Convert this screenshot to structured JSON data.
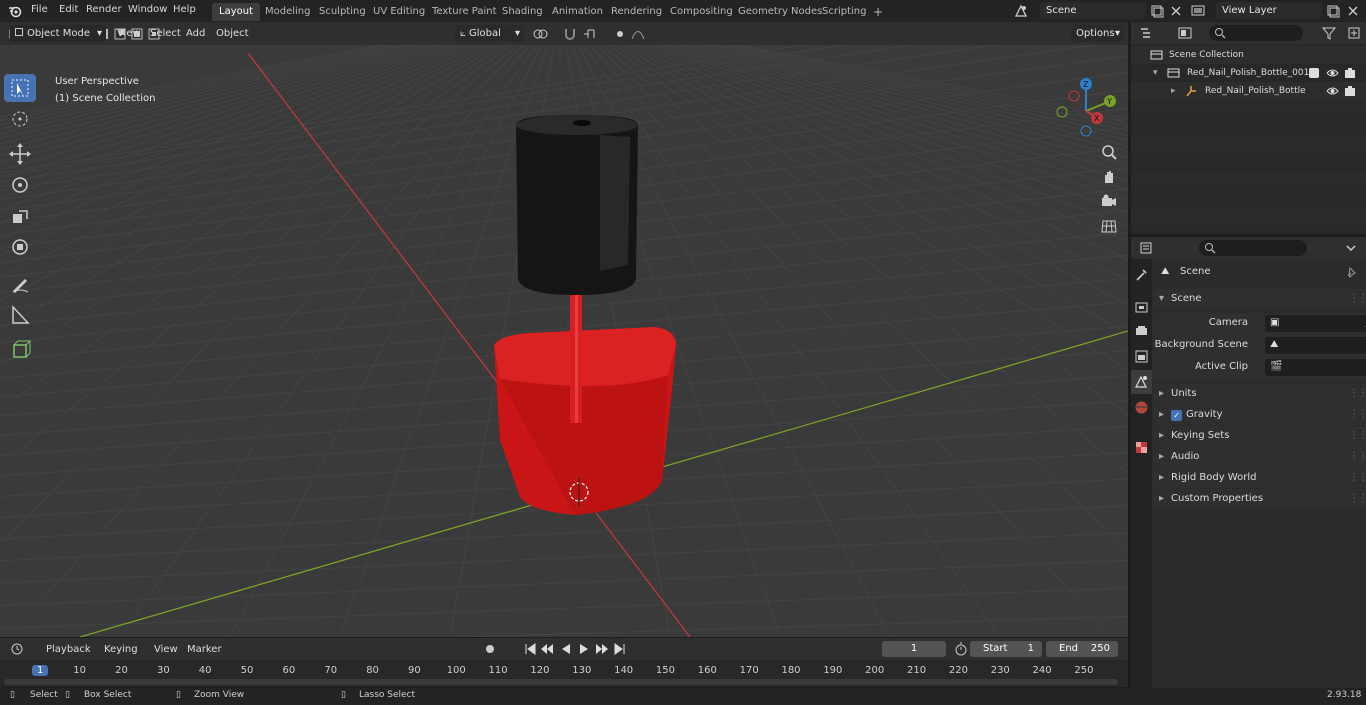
{
  "topbar": {
    "menus": [
      "File",
      "Edit",
      "Render",
      "Window",
      "Help"
    ],
    "workspaces": [
      "Layout",
      "Modeling",
      "Sculpting",
      "UV Editing",
      "Texture Paint",
      "Shading",
      "Animation",
      "Rendering",
      "Compositing",
      "Geometry Nodes",
      "Scripting"
    ],
    "active_workspace": "Layout",
    "add_tab": "+",
    "scene_name": "Scene",
    "view_layer": "View Layer"
  },
  "viewport_header": {
    "mode": "Object Mode",
    "menus": [
      "View",
      "Select",
      "Add",
      "Object"
    ],
    "transform_orientation": "Global",
    "options": "Options"
  },
  "viewport": {
    "perspective_label": "User Perspective",
    "collection_label": "(1) Scene Collection",
    "axis_labels": {
      "z": "Z",
      "y": "Y",
      "x": "X"
    },
    "colors": {
      "x_axis": "#c0393f",
      "y_axis": "#7ba12a",
      "bottle": "#d01818",
      "cap": "#141414",
      "grid": "#434343",
      "bg": "#3a3a3a",
      "active_tool": "#4772b3"
    }
  },
  "outliner": {
    "root": "Scene Collection",
    "items": [
      "Red_Nail_Polish_Bottle_001",
      "Red_Nail_Polish_Bottle"
    ]
  },
  "properties": {
    "context_label": "Scene",
    "panel_title": "Scene",
    "fields": [
      {
        "label": "Camera"
      },
      {
        "label": "Background Scene"
      },
      {
        "label": "Active Clip"
      }
    ],
    "subpanels": [
      "Units",
      "Gravity",
      "Keying Sets",
      "Audio",
      "Rigid Body World",
      "Custom Properties"
    ]
  },
  "timeline": {
    "menus": [
      "Playback",
      "Keying",
      "View",
      "Marker"
    ],
    "current_frame": "1",
    "start_label": "Start",
    "start": "1",
    "end_label": "End",
    "end": "250",
    "ticks": [
      "1",
      "10",
      "20",
      "30",
      "40",
      "50",
      "60",
      "70",
      "80",
      "90",
      "100",
      "110",
      "120",
      "130",
      "140",
      "150",
      "160",
      "170",
      "180",
      "190",
      "200",
      "210",
      "220",
      "230",
      "240",
      "250"
    ]
  },
  "statusbar": {
    "items": [
      "Select",
      "Box Select",
      "Zoom View",
      "Lasso Select"
    ],
    "version": "2.93.18"
  }
}
